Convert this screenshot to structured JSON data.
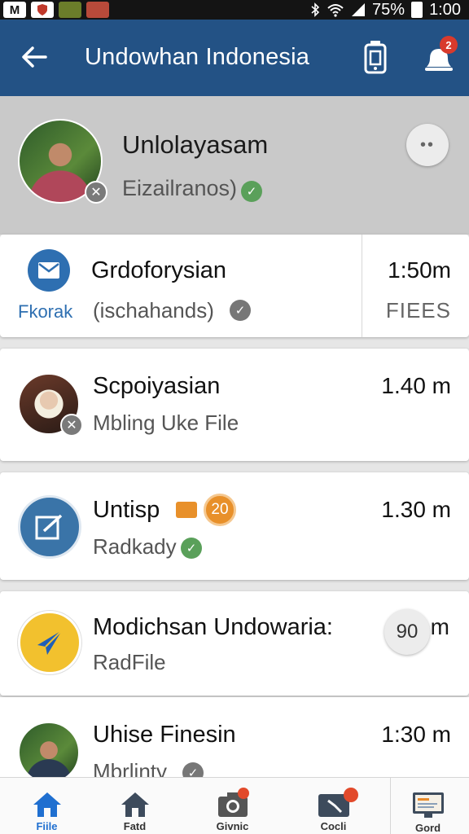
{
  "status_bar": {
    "battery": "75%",
    "time": "1:00"
  },
  "app_bar": {
    "title": "Undowhan Indonesia",
    "notification_count": "2"
  },
  "profile": {
    "name": "Unlolayasam",
    "subtitle": "Eizailranos)"
  },
  "items": [
    {
      "title": "Grdoforysian",
      "subtitle": "(ischahands)",
      "time": "1:50m",
      "side_label": "FIEES",
      "brand_label": "Fkorak",
      "icon": "mail-icon"
    },
    {
      "title": "Scpoiyasian",
      "subtitle": "Mbling Uke File",
      "time": "1.40 m",
      "icon": "avatar"
    },
    {
      "title": "Untisp",
      "badge": "20",
      "subtitle": "Radkady",
      "time": "1.30 m",
      "icon": "edit-icon"
    },
    {
      "title": "Modichsan Undowaria:",
      "subtitle": "RadFile",
      "badge": "90",
      "time_unit": "m",
      "icon": "send-icon"
    },
    {
      "title": "Uhise Finesin",
      "subtitle": "Mbrlinty",
      "time": "1:30 m",
      "icon": "avatar"
    }
  ],
  "bottom_nav": [
    {
      "label": "Fiile",
      "icon": "home-icon",
      "active": true
    },
    {
      "label": "Fatd",
      "icon": "home-icon",
      "active": false
    },
    {
      "label": "Givnic",
      "icon": "camera-icon",
      "active": false
    },
    {
      "label": "Cocli",
      "icon": "media-icon",
      "active": false
    },
    {
      "label": "Gord",
      "icon": "desktop-icon",
      "active": false
    }
  ],
  "colors": {
    "app_bar": "#235285",
    "accent_blue": "#1f6fd0",
    "verified_green": "#5aa05a",
    "badge_orange": "#e8902a",
    "notification_red": "#d83a2c"
  }
}
